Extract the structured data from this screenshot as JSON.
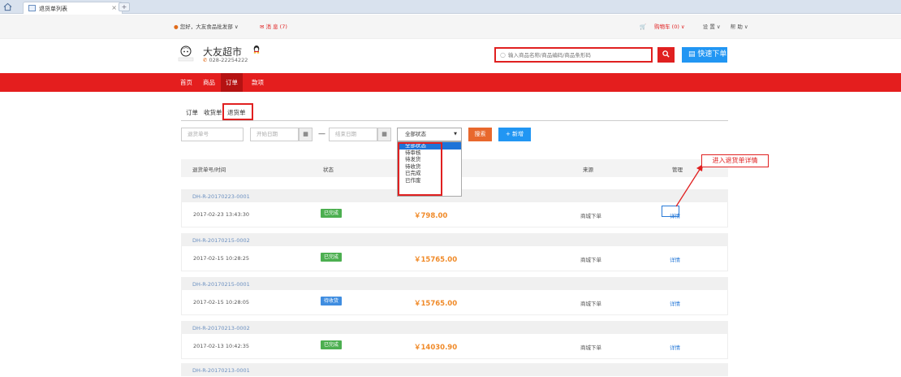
{
  "browser": {
    "tab_title": "退货单列表",
    "close_glyph": "×",
    "new_tab_glyph": "+"
  },
  "topbar": {
    "greeting": "您好，大友食品批发部 ∨",
    "messages": "消 息 (7)",
    "cart": "购物车 (0) ∨",
    "settings": "设 置 ∨",
    "help": "帮 助 ∨"
  },
  "header": {
    "store_name": "大友超市",
    "phone": "028-22254222",
    "search_placeholder": "输入商品名称/商品编码/商品条形码",
    "quick_order": "快速下单"
  },
  "nav": {
    "items": [
      "首页",
      "商品",
      "订单",
      "款项"
    ],
    "active": "订单"
  },
  "subtabs": {
    "items": [
      "订单",
      "收货单",
      "退货单"
    ],
    "active": "退货单"
  },
  "filters": {
    "order_no_placeholder": "退货单号",
    "start_date_placeholder": "开始日期",
    "end_date_placeholder": "结束日期",
    "dash": "—",
    "status_selected": "全部状态",
    "search_label": "搜索",
    "new_label": "+ 新增"
  },
  "status_options": [
    "全部状态",
    "待审核",
    "待发货",
    "待收货",
    "已完成",
    "已作废"
  ],
  "table": {
    "headers": {
      "order": "退货单号/时间",
      "status": "状态",
      "source": "来源",
      "manage": "管理"
    },
    "rows": [
      {
        "id": "DH-R-20170223-0001",
        "time": "2017-02-23 13:43:30",
        "status": "已完成",
        "status_color": "green",
        "amount": "￥798.00",
        "source": "商城下单",
        "action": "详情"
      },
      {
        "id": "DH-R-20170215-0002",
        "time": "2017-02-15 10:28:25",
        "status": "已完成",
        "status_color": "green",
        "amount": "￥15765.00",
        "source": "商城下单",
        "action": "详情"
      },
      {
        "id": "DH-R-20170215-0001",
        "time": "2017-02-15 10:28:05",
        "status": "待收货",
        "status_color": "blue",
        "amount": "￥15765.00",
        "source": "商城下单",
        "action": "详情"
      },
      {
        "id": "DH-R-20170213-0002",
        "time": "2017-02-13 10:42:35",
        "status": "已完成",
        "status_color": "green",
        "amount": "￥14030.90",
        "source": "商城下单",
        "action": "详情"
      }
    ],
    "partial_row_id": "DH-R-20170213-0001"
  },
  "annotation": "进入退货单详情",
  "colors": {
    "brand_red": "#e41e1e",
    "accent_blue": "#2196f3",
    "search_orange": "#e8682d",
    "amount_orange": "#f08a28",
    "status_green": "#4caf50",
    "status_blue": "#3f8de0"
  }
}
